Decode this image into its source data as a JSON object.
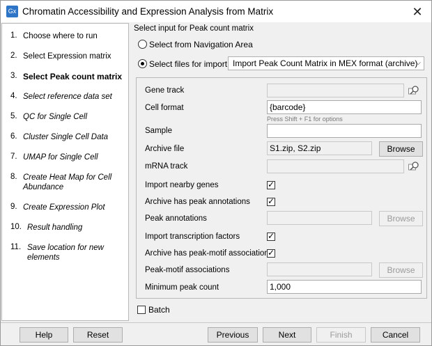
{
  "window": {
    "title": "Chromatin Accessibility and Expression Analysis from Matrix",
    "app_icon": "Gx"
  },
  "steps": [
    {
      "num": "1.",
      "label": "Choose where to run",
      "state": "done"
    },
    {
      "num": "2.",
      "label": "Select Expression matrix",
      "state": "done"
    },
    {
      "num": "3.",
      "label": "Select Peak count matrix",
      "state": "current"
    },
    {
      "num": "4.",
      "label": "Select reference data set",
      "state": "future"
    },
    {
      "num": "5.",
      "label": "QC for Single Cell",
      "state": "future"
    },
    {
      "num": "6.",
      "label": "Cluster Single Cell Data",
      "state": "future"
    },
    {
      "num": "7.",
      "label": "UMAP for Single Cell",
      "state": "future"
    },
    {
      "num": "8.",
      "label": "Create Heat Map for Cell Abundance",
      "state": "future"
    },
    {
      "num": "9.",
      "label": "Create Expression Plot",
      "state": "future"
    },
    {
      "num": "10.",
      "label": "Result handling",
      "state": "future"
    },
    {
      "num": "11.",
      "label": "Save location for new elements",
      "state": "future"
    }
  ],
  "main": {
    "section_title": "Select input for Peak count matrix",
    "radio_nav": "Select from Navigation Area",
    "radio_files": "Select files for import:",
    "import_format": "Import Peak Count Matrix in MEX format (archive)",
    "fields": {
      "gene_track": {
        "label": "Gene track",
        "value": ""
      },
      "cell_format": {
        "label": "Cell format",
        "value": "{barcode}",
        "hint": "Press Shift + F1 for options"
      },
      "sample": {
        "label": "Sample",
        "value": ""
      },
      "archive_file": {
        "label": "Archive file",
        "value": "S1.zip, S2.zip",
        "button": "Browse"
      },
      "mrna_track": {
        "label": "mRNA track",
        "value": ""
      },
      "import_nearby_genes": {
        "label": "Import nearby genes",
        "checked": true
      },
      "archive_peak_annotations": {
        "label": "Archive has peak annotations",
        "checked": true
      },
      "peak_annotations": {
        "label": "Peak annotations",
        "value": "",
        "button": "Browse"
      },
      "import_tf": {
        "label": "Import transcription factors",
        "checked": true
      },
      "archive_peak_motif": {
        "label": "Archive has peak-motif associations",
        "checked": true
      },
      "peak_motif": {
        "label": "Peak-motif associations",
        "value": "",
        "button": "Browse"
      },
      "min_peak_count": {
        "label": "Minimum peak count",
        "value": "1,000"
      }
    },
    "batch_label": "Batch"
  },
  "footer": {
    "help": "Help",
    "reset": "Reset",
    "previous": "Previous",
    "next": "Next",
    "finish": "Finish",
    "cancel": "Cancel"
  }
}
